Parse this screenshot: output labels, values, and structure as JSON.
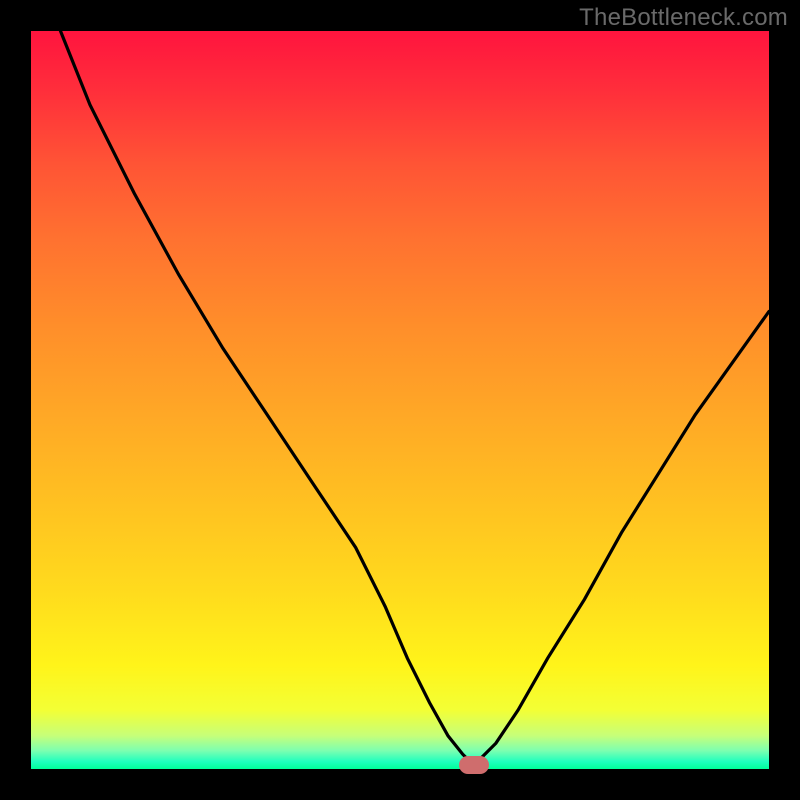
{
  "watermark": "TheBottleneck.com",
  "colors": {
    "frame_bg": "#000000",
    "curve": "#000000",
    "marker": "#cf6d6d"
  },
  "chart_data": {
    "type": "line",
    "title": "",
    "xlabel": "",
    "ylabel": "",
    "xlim": [
      0,
      100
    ],
    "ylim": [
      0,
      100
    ],
    "grid": false,
    "legend": false,
    "series": [
      {
        "name": "curve",
        "x": [
          4,
          8,
          14,
          20,
          26,
          32,
          38,
          44,
          48,
          51,
          54,
          56.5,
          58.5,
          60,
          63,
          66,
          70,
          75,
          80,
          85,
          90,
          95,
          100
        ],
        "values": [
          100,
          90,
          78,
          67,
          57,
          48,
          39,
          30,
          22,
          15,
          9,
          4.5,
          2,
          0.5,
          3.5,
          8,
          15,
          23,
          32,
          40,
          48,
          55,
          62
        ]
      }
    ],
    "marker": {
      "x": 60,
      "y": 0.5
    },
    "background_gradient": {
      "top": "#ff143e",
      "mid": "#ffdb1d",
      "bottom": "#00ff9a"
    }
  }
}
